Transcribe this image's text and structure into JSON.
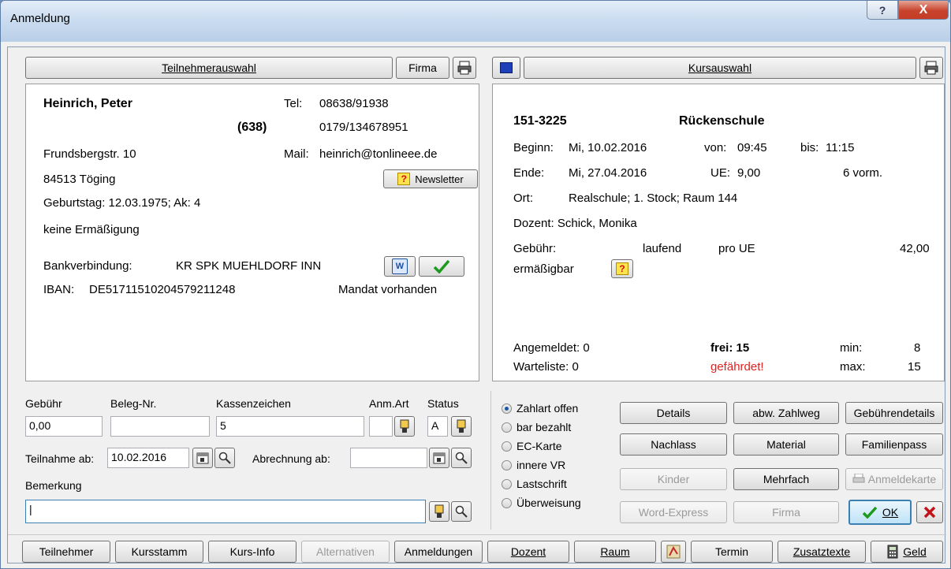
{
  "window": {
    "title": "Anmeldung",
    "help_glyph": "?",
    "close_glyph": "X"
  },
  "participant": {
    "select_button": "Teilnehmerauswahl",
    "company_button": "Firma",
    "name": "Heinrich, Peter",
    "number": "(638)",
    "tel_label": "Tel:",
    "tel1": "08638/91938",
    "tel2": "0179/134678951",
    "street": "Frundsbergstr. 10",
    "mail_label": "Mail:",
    "mail": "heinrich@tonlineee.de",
    "city": "84513 Töging",
    "newsletter_button": "Newsletter",
    "birthday": "Geburtstag: 12.03.1975; Ak: 4",
    "discount": "keine Ermäßigung",
    "bank_label": "Bankverbindung:",
    "bank": "KR SPK MUEHLDORF INN",
    "iban_label": "IBAN:",
    "iban": "DE51711510204579211248",
    "mandate": "Mandat vorhanden"
  },
  "course": {
    "select_button": "Kursauswahl",
    "number": "151-3225",
    "name": "Rückenschule",
    "begin_label": "Beginn:",
    "begin": "Mi, 10.02.2016",
    "from_label": "von:",
    "from": "09:45",
    "to_label": "bis:",
    "to": "11:15",
    "end_label": "Ende:",
    "end": "Mi, 27.04.2016",
    "ue_label": "UE:",
    "ue": "9,00",
    "ue_extra": "6 vorm.",
    "place_label": "Ort:",
    "place": "Realschule; 1. Stock; Raum 144",
    "teacher": "Dozent: Schick, Monika",
    "fee_label": "Gebühr:",
    "fee_mode": "laufend",
    "fee_unit": "pro UE",
    "fee_value": "42,00",
    "reducible": "ermäßigbar",
    "registered": "Angemeldet: 0",
    "free": "frei: 15",
    "min_label": "min:",
    "min": "8",
    "waitlist": "Warteliste: 0",
    "endangered": "gefährdet!",
    "max_label": "max:",
    "max": "15"
  },
  "form": {
    "fee_label": "Gebühr",
    "fee_value": "0,00",
    "receipt_label": "Beleg-Nr.",
    "receipt_value": "",
    "cash_label": "Kassenzeichen",
    "cash_value": "5",
    "type_label": "Anm.Art",
    "type_value": "",
    "status_label": "Status",
    "status_value": "A",
    "participation_label": "Teilnahme ab:",
    "participation_value": "10.02.2016",
    "billing_label": "Abrechnung ab:",
    "billing_value": "",
    "remark_label": "Bemerkung",
    "remark_value": "|"
  },
  "payment": {
    "options": [
      "Zahlart offen",
      "bar bezahlt",
      "EC-Karte",
      "innere VR",
      "Lastschrift",
      "Überweisung"
    ],
    "selected": "Zahlart offen"
  },
  "actions": {
    "details": "Details",
    "alt_payment": "abw. Zahlweg",
    "fee_details": "Gebührendetails",
    "discount": "Nachlass",
    "material": "Material",
    "family_pass": "Familienpass",
    "children": "Kinder",
    "multiple": "Mehrfach",
    "reg_card": "Anmeldekarte",
    "word_express": "Word-Express",
    "company": "Firma",
    "ok": "OK"
  },
  "toolbar": {
    "participant": "Teilnehmer",
    "course_master": "Kursstamm",
    "course_info": "Kurs-Info",
    "alternatives": "Alternativen",
    "registrations": "Anmeldungen",
    "teacher": "Dozent",
    "room": "Raum",
    "date": "Termin",
    "extra_texts": "Zusatztexte",
    "money": "Geld"
  },
  "colors": {
    "accent": "#3c7fb1",
    "warning": "#e02020",
    "ok_check": "#1e9a1e",
    "cancel_x": "#c0141a"
  }
}
